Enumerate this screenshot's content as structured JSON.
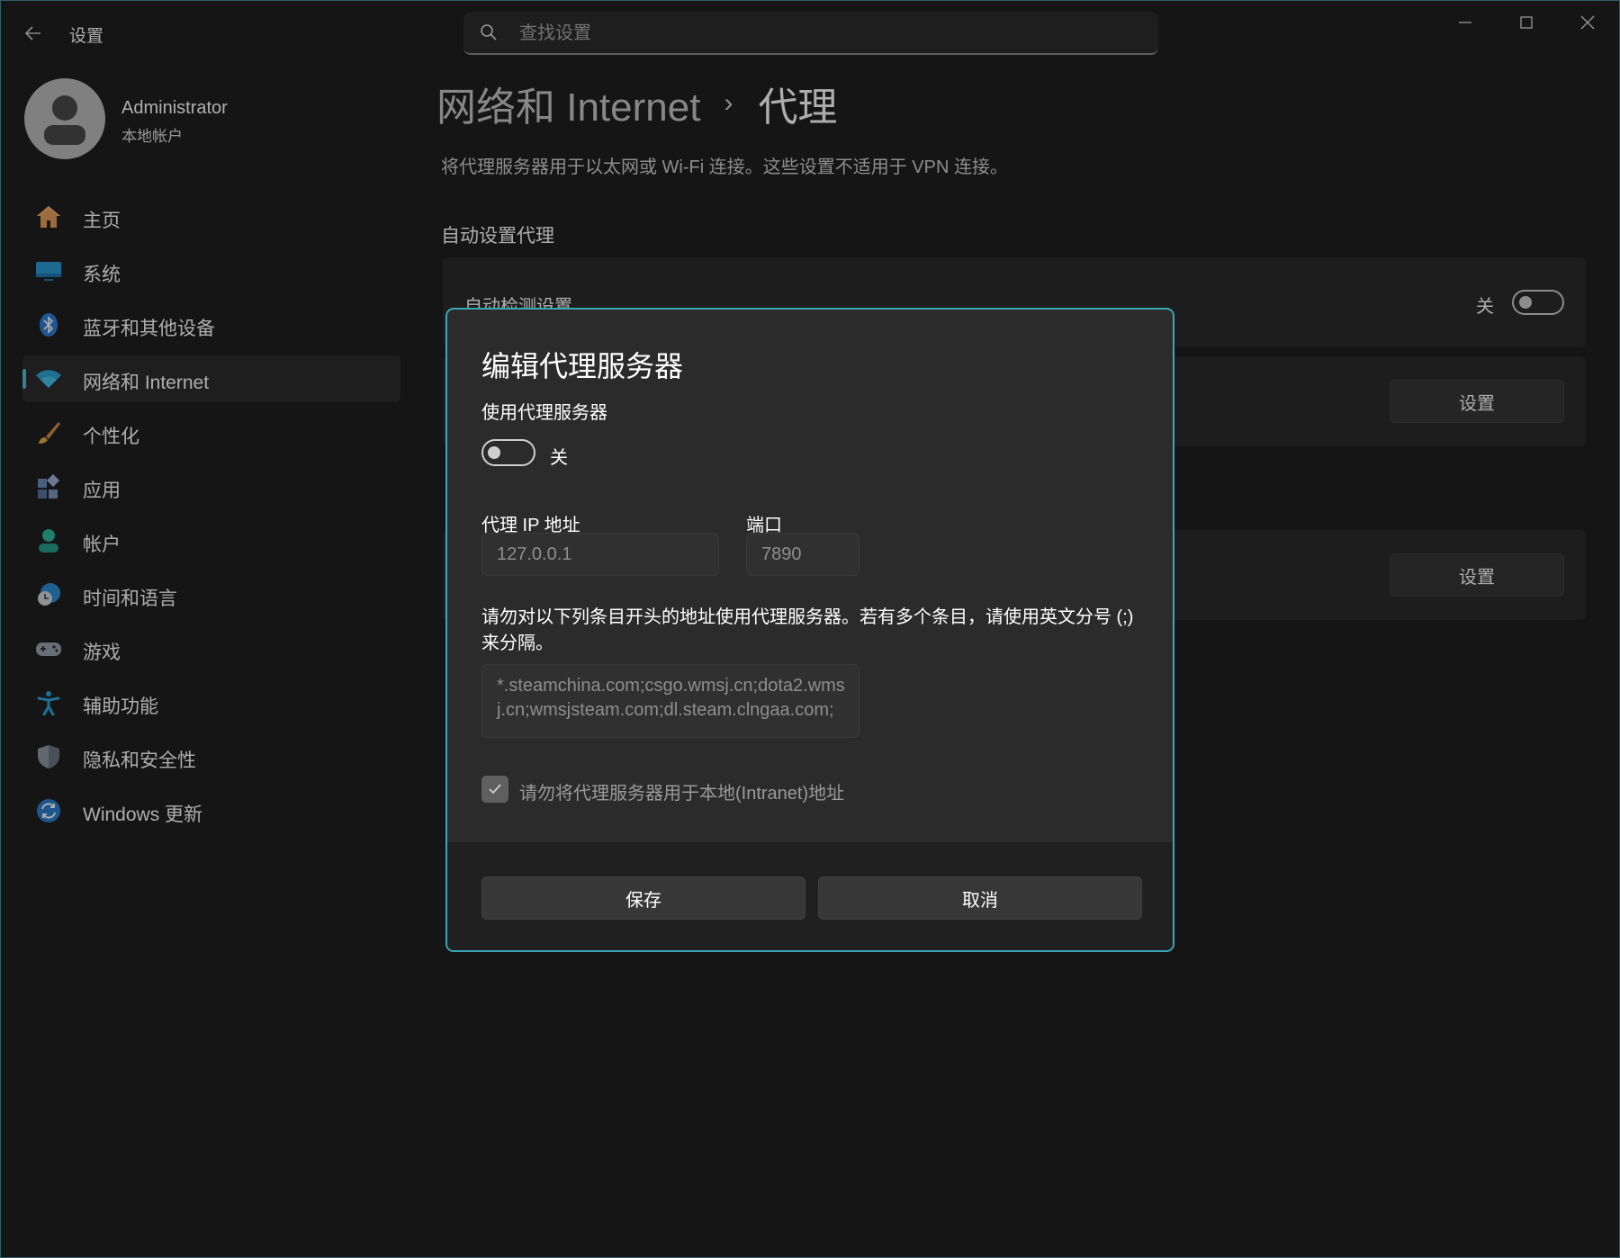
{
  "app": {
    "title": "设置"
  },
  "search": {
    "placeholder": "查找设置"
  },
  "profile": {
    "name": "Administrator",
    "subtitle": "本地帐户"
  },
  "sidebar": {
    "items": [
      {
        "label": "主页",
        "icon": "home-icon"
      },
      {
        "label": "系统",
        "icon": "system-icon"
      },
      {
        "label": "蓝牙和其他设备",
        "icon": "bluetooth-icon"
      },
      {
        "label": "网络和 Internet",
        "icon": "wifi-icon",
        "active": true
      },
      {
        "label": "个性化",
        "icon": "brush-icon"
      },
      {
        "label": "应用",
        "icon": "apps-icon"
      },
      {
        "label": "帐户",
        "icon": "account-icon"
      },
      {
        "label": "时间和语言",
        "icon": "time-language-icon"
      },
      {
        "label": "游戏",
        "icon": "gamepad-icon"
      },
      {
        "label": "辅助功能",
        "icon": "accessibility-icon"
      },
      {
        "label": "隐私和安全性",
        "icon": "shield-icon"
      },
      {
        "label": "Windows 更新",
        "icon": "update-icon"
      }
    ]
  },
  "page": {
    "breadcrumb_parent": "网络和 Internet",
    "breadcrumb_current": "代理",
    "description": "将代理服务器用于以太网或 Wi-Fi 连接。这些设置不适用于 VPN 连接。",
    "auto_section_title": "自动设置代理",
    "auto_detect_label": "自动检测设置",
    "auto_detect_state": "关",
    "setup_button_1": "设置",
    "setup_button_2": "设置"
  },
  "dialog": {
    "title": "编辑代理服务器",
    "use_proxy_label": "使用代理服务器",
    "use_proxy_state": "关",
    "ip_label": "代理 IP 地址",
    "ip_value": "127.0.0.1",
    "port_label": "端口",
    "port_value": "7890",
    "exclusion_note": "请勿对以下列条目开头的地址使用代理服务器。若有多个条目，请使用英文分号 (;) 来分隔。",
    "exclusions_value": "*.steamchina.com;csgo.wmsj.cn;dota2.wmsj.cn;wmsjsteam.com;dl.steam.clngaa.com;",
    "local_bypass_label": "请勿将代理服务器用于本地(Intranet)地址",
    "local_bypass_checked": true,
    "save_label": "保存",
    "cancel_label": "取消"
  },
  "colors": {
    "accent": "#4cc2d8",
    "dialog_border": "#3aa8b8",
    "background": "#202020"
  }
}
